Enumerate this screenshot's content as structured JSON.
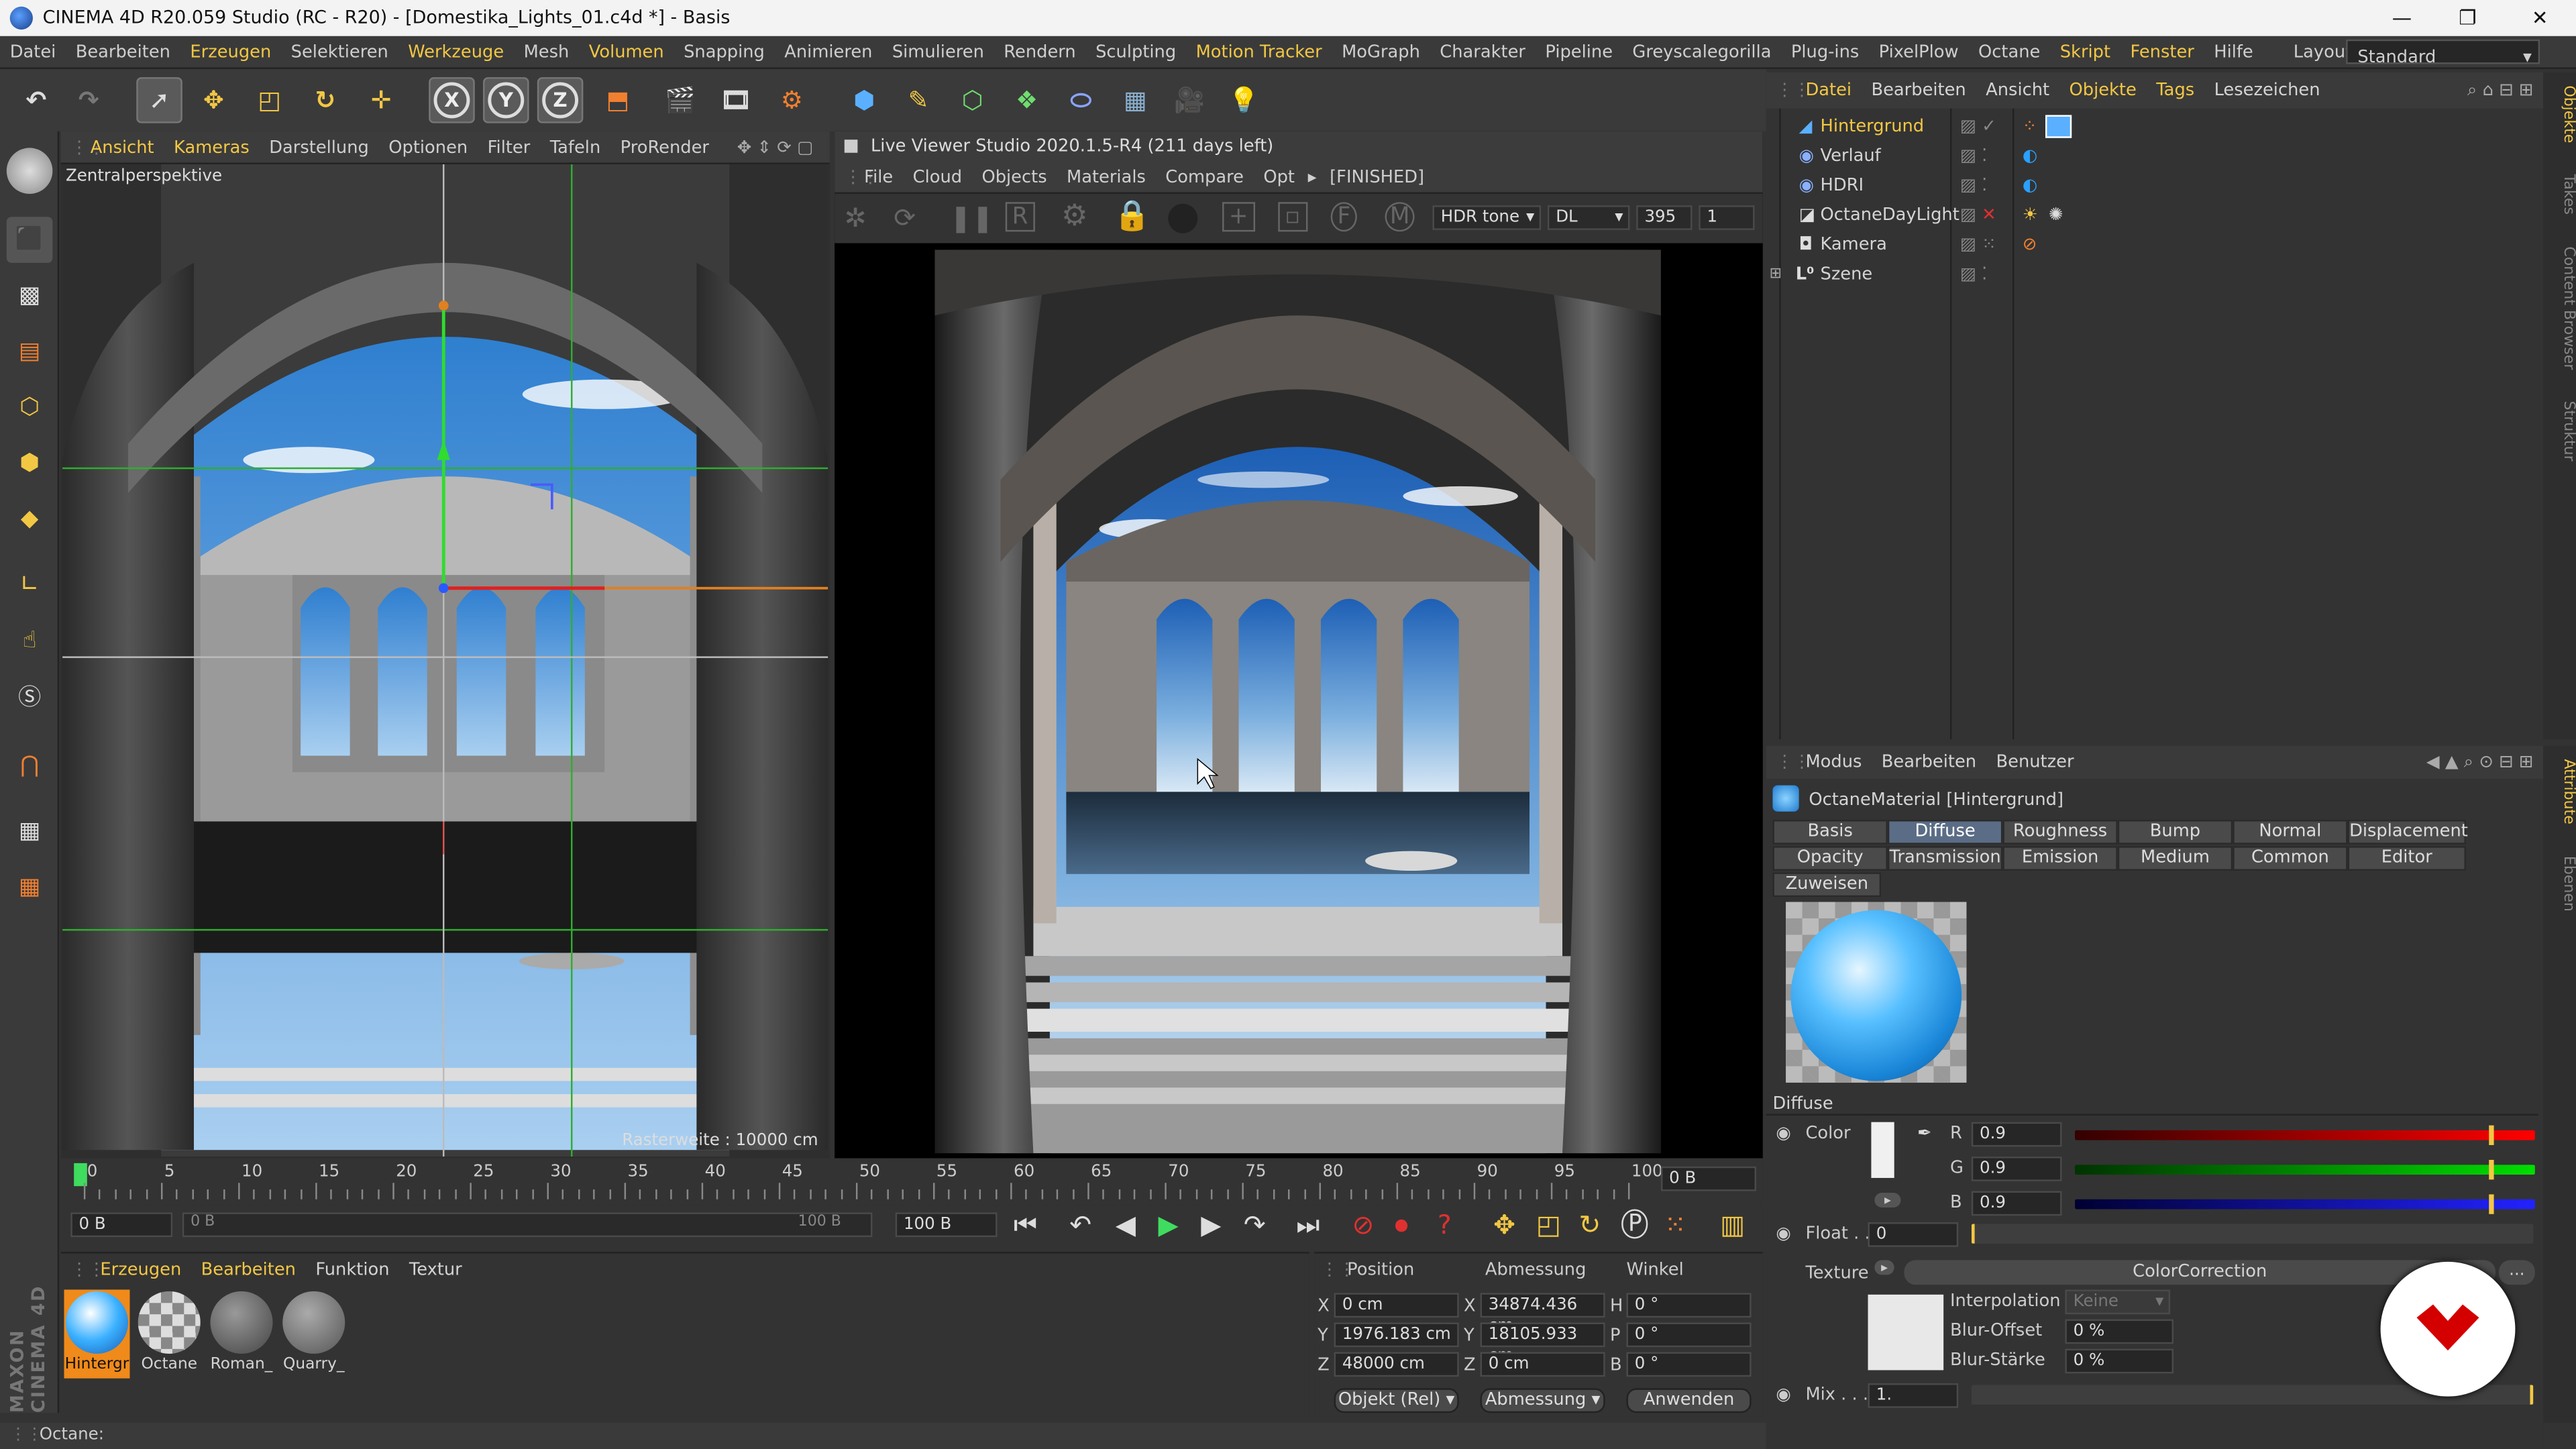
{
  "titlebar": {
    "title": "CINEMA 4D R20.059 Studio (RC - R20) - [Domestika_Lights_01.c4d *] - Basis",
    "minimize": "—",
    "maximize": "❐",
    "close": "✕"
  },
  "menubar": {
    "items": [
      "Datei",
      "Bearbeiten",
      "Erzeugen",
      "Selektieren",
      "Werkzeuge",
      "Mesh",
      "Volumen",
      "Snapping",
      "Animieren",
      "Simulieren",
      "Rendern",
      "Sculpting",
      "Motion Tracker",
      "MoGraph",
      "Charakter",
      "Pipeline",
      "Greyscalegorilla",
      "Plug-ins",
      "PixelPlow",
      "Octane",
      "Skript",
      "Fenster",
      "Hilfe"
    ],
    "layout_label": "Layout:",
    "layout_value": "Standard"
  },
  "viewport": {
    "menu": [
      "Ansicht",
      "Kameras",
      "Darstellung",
      "Optionen",
      "Filter",
      "Tafeln",
      "ProRender"
    ],
    "perspective": "Zentralperspektive",
    "grid_label": "Rasterweite : 10000 cm"
  },
  "live_viewer": {
    "title": "Live Viewer Studio 2020.1.5-R4 (211 days left)",
    "menu": [
      "File",
      "Cloud",
      "Objects",
      "Materials",
      "Compare",
      "Opt"
    ],
    "status": "[FINISHED]",
    "tone": "HDR tone",
    "mode": "DL",
    "samples": "395",
    "count": "1"
  },
  "objects_panel": {
    "menu": [
      "Datei",
      "Bearbeiten",
      "Ansicht",
      "Objekte",
      "Tags",
      "Lesezeichen"
    ],
    "items": [
      {
        "name": "Hintergrund",
        "selected": true
      },
      {
        "name": "Verlauf",
        "selected": false
      },
      {
        "name": "HDRI",
        "selected": false
      },
      {
        "name": "OctaneDayLight",
        "selected": false
      },
      {
        "name": "Kamera",
        "selected": false
      },
      {
        "name": "Szene",
        "selected": false
      }
    ]
  },
  "attributes": {
    "menu": [
      "Modus",
      "Bearbeiten",
      "Benutzer"
    ],
    "material_title": "OctaneMaterial [Hintergrund]",
    "tabs_row1": [
      "Basis",
      "Diffuse",
      "Roughness",
      "Bump",
      "Normal",
      "Displacement"
    ],
    "tabs_row2": [
      "Opacity",
      "Transmission",
      "Emission",
      "Medium",
      "Common",
      "Editor"
    ],
    "tab_assign": "Zuweisen",
    "section": "Diffuse",
    "color_label": "Color",
    "r_label": "R",
    "r_value": "0.9",
    "r_level": 0.9,
    "g_label": "G",
    "g_value": "0.9",
    "g_level": 0.9,
    "b_label": "B",
    "b_value": "0.9",
    "b_level": 0.9,
    "float_label": "Float . .",
    "float_value": "0",
    "texture_label": "Texture",
    "texture_value": "ColorCorrection",
    "texture_more": "...",
    "interpolation_label": "Interpolation",
    "interpolation_value": "Keine",
    "blur_offset_label": "Blur-Offset",
    "blur_offset_value": "0 %",
    "blur_strength_label": "Blur-Stärke",
    "blur_strength_value": "0 %",
    "mix_label": "Mix . . .",
    "mix_value": "1."
  },
  "timeline": {
    "ticks": [
      "0",
      "5",
      "10",
      "15",
      "20",
      "25",
      "30",
      "35",
      "40",
      "45",
      "50",
      "55",
      "60",
      "65",
      "70",
      "75",
      "80",
      "85",
      "90",
      "95",
      "100"
    ],
    "frame_end_field": "0 B",
    "start": "0 B",
    "range_start": "0 B",
    "range_end": "100 B",
    "end": "100 B"
  },
  "material_manager": {
    "menu": [
      "Erzeugen",
      "Bearbeiten",
      "Funktion",
      "Textur"
    ],
    "materials": [
      "Hintergr",
      "Octane",
      "Roman_",
      "Quarry_"
    ]
  },
  "coords": {
    "headers": [
      "Position",
      "Abmessung",
      "Winkel"
    ],
    "rows": [
      {
        "axis": "X",
        "pos": "0 cm",
        "size_axis": "X",
        "size": "34874.436 cm",
        "ang_axis": "H",
        "ang": "0 °"
      },
      {
        "axis": "Y",
        "pos": "1976.183 cm",
        "size_axis": "Y",
        "size": "18105.933 cm",
        "ang_axis": "P",
        "ang": "0 °"
      },
      {
        "axis": "Z",
        "pos": "48000 cm",
        "size_axis": "Z",
        "size": "0 cm",
        "ang_axis": "B",
        "ang": "0 °"
      }
    ],
    "mode": "Objekt (Rel)",
    "size_mode": "Abmessung",
    "apply": "Anwenden"
  },
  "status": "Octane:",
  "brand": "MAXON CINEMA 4D",
  "colors": {
    "accent": "#f2c744",
    "selected_tab": "#5b6d86",
    "red": "#d40000"
  }
}
